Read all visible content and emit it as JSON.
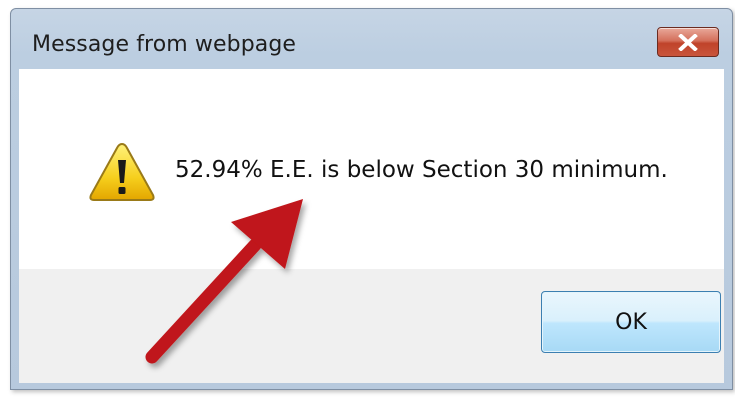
{
  "dialog": {
    "title": "Message from webpage",
    "message": "52.94% E.E. is below Section 30 minimum.",
    "ok_label": "OK",
    "icon": "warning-icon",
    "close_icon": "close-icon"
  },
  "annotation": {
    "arrow_color": "#c0181a",
    "arrow_icon": "arrow-annotation"
  },
  "colors": {
    "titlebar": "#bccee1",
    "close_button": "#c9553c",
    "footer": "#f0f0f0",
    "ok_button_border": "#3c7fb1"
  }
}
